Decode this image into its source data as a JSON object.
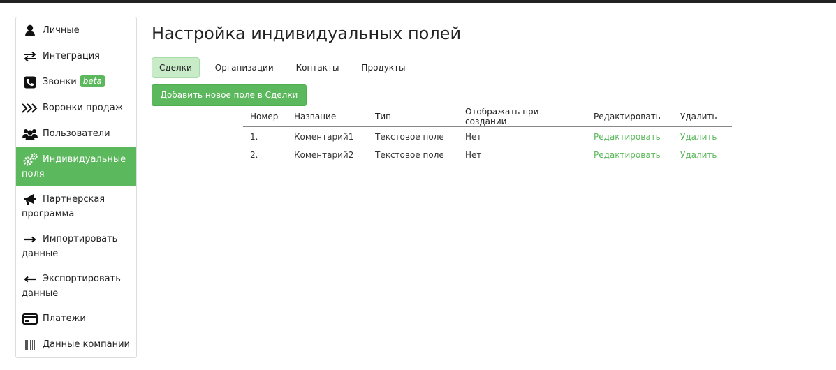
{
  "sidebar": {
    "items": [
      {
        "label": "Личные",
        "icon": "user-icon"
      },
      {
        "label": "Интеграция",
        "icon": "exchange-icon"
      },
      {
        "label": "Звонки",
        "icon": "phone-icon",
        "badge": "beta"
      },
      {
        "label": "Воронки продаж",
        "icon": "chevrons-icon"
      },
      {
        "label": "Пользователи",
        "icon": "users-icon"
      },
      {
        "label1": "Индивидуальные",
        "label2": "поля",
        "icon": "gears-icon",
        "active": true
      },
      {
        "label1": "Партнерская",
        "label2": "программа",
        "icon": "megaphone-icon"
      },
      {
        "label1": "Импортировать",
        "label2": "данные",
        "icon": "arrow-right-icon"
      },
      {
        "label1": "Экспортировать",
        "label2": "данные",
        "icon": "arrow-left-icon"
      },
      {
        "label": "Платежи",
        "icon": "credit-card-icon"
      },
      {
        "label": "Данные компании",
        "icon": "barcode-icon"
      }
    ]
  },
  "main": {
    "title": "Настройка индивидуальных полей",
    "tabs": [
      "Сделки",
      "Организации",
      "Контакты",
      "Продукты"
    ],
    "active_tab": "Сделки",
    "add_button": "Добавить новое поле в Сделки",
    "table": {
      "headers": [
        "Номер",
        "Название",
        "Тип",
        "Отображать при создании",
        "Редактировать",
        "Удалить"
      ],
      "rows": [
        [
          "1.",
          "Коментарий1",
          "Текстовое поле",
          "Нет",
          "Редактировать",
          "Удалить"
        ],
        [
          "2.",
          "Коментарий2",
          "Текстовое поле",
          "Нет",
          "Редактировать",
          "Удалить"
        ]
      ]
    }
  },
  "colors": {
    "accent": "#5cb85c",
    "tab_active_bg": "#c8ecc8",
    "topbar": "#222222"
  }
}
